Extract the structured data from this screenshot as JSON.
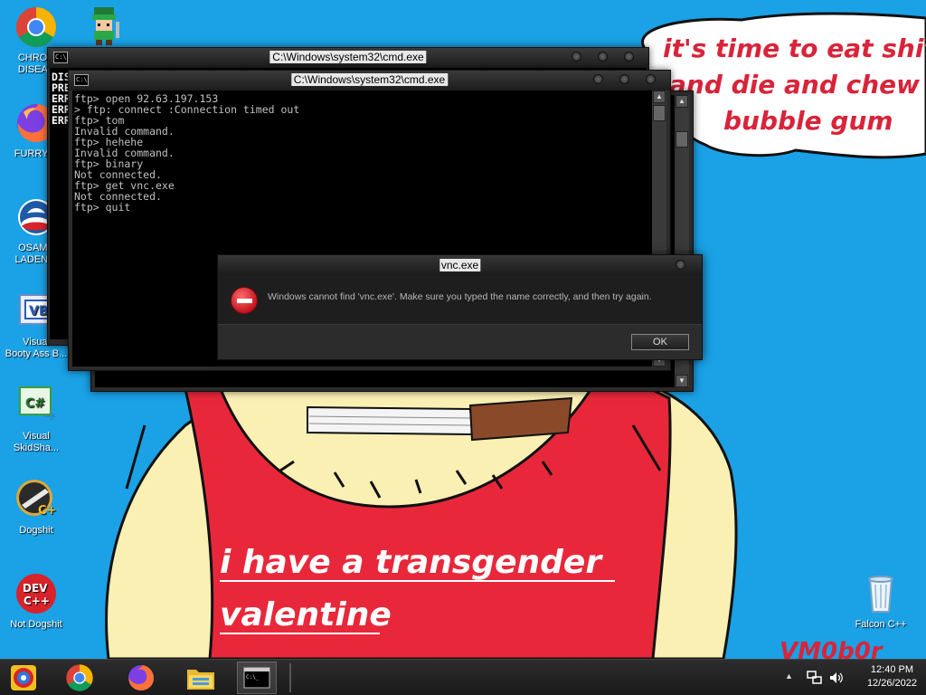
{
  "desktop": {
    "icons": [
      {
        "label": "CHRON\nDISEAS",
        "icon": "chrome-icon"
      },
      {
        "label": "FURRY C",
        "icon": "firefox-icon"
      },
      {
        "label": "OSAMA\nLADEN B",
        "icon": "obama-logo-icon"
      },
      {
        "label": "Visual\nBooty Ass B...",
        "icon": "visual-basic-icon"
      },
      {
        "label": "Visual\nSkidSha...",
        "icon": "csharp-icon"
      },
      {
        "label": "Dogshit",
        "icon": "cpp-builder-icon"
      },
      {
        "label": "Not Dogshit",
        "icon": "dev-cpp-icon"
      },
      {
        "label": "Falcon C++",
        "icon": "recycle-bin-icon"
      }
    ]
  },
  "wallpaper": {
    "speech_line1": "it's time to eat shit",
    "speech_line2": "and die and chew",
    "speech_line3": "bubble gum",
    "shirt_line1": "i have a transgender",
    "shirt_line2": "valentine",
    "signature": "VM0b0r",
    "colors": {
      "sky": "#1aa1e6",
      "shirt": "#e8283a",
      "skin": "#fbf0b4"
    }
  },
  "cmd_back": {
    "title": "C:\\Windows\\system32\\cmd.exe",
    "lines": [
      "DIS",
      "PRE",
      "ERR",
      "ERR",
      "ERR"
    ]
  },
  "cmd_front": {
    "title": "C:\\Windows\\system32\\cmd.exe",
    "lines": [
      "ftp> open 92.63.197.153",
      "> ftp: connect :Connection timed out",
      "ftp> tom",
      "Invalid command.",
      "ftp> hehehe",
      "Invalid command.",
      "ftp> binary",
      "Not connected.",
      "ftp> get vnc.exe",
      "Not connected.",
      "ftp> quit"
    ]
  },
  "dialog": {
    "title": "vnc.exe",
    "message": "Windows cannot find 'vnc.exe'. Make sure you typed the name correctly, and then try again.",
    "ok_label": "OK"
  },
  "taskbar": {
    "items": [
      "start-orb-icon",
      "chrome-icon",
      "firefox-icon",
      "file-explorer-icon",
      "cmd-icon"
    ],
    "clock_time": "12:40 PM",
    "clock_date": "12/26/2022"
  }
}
